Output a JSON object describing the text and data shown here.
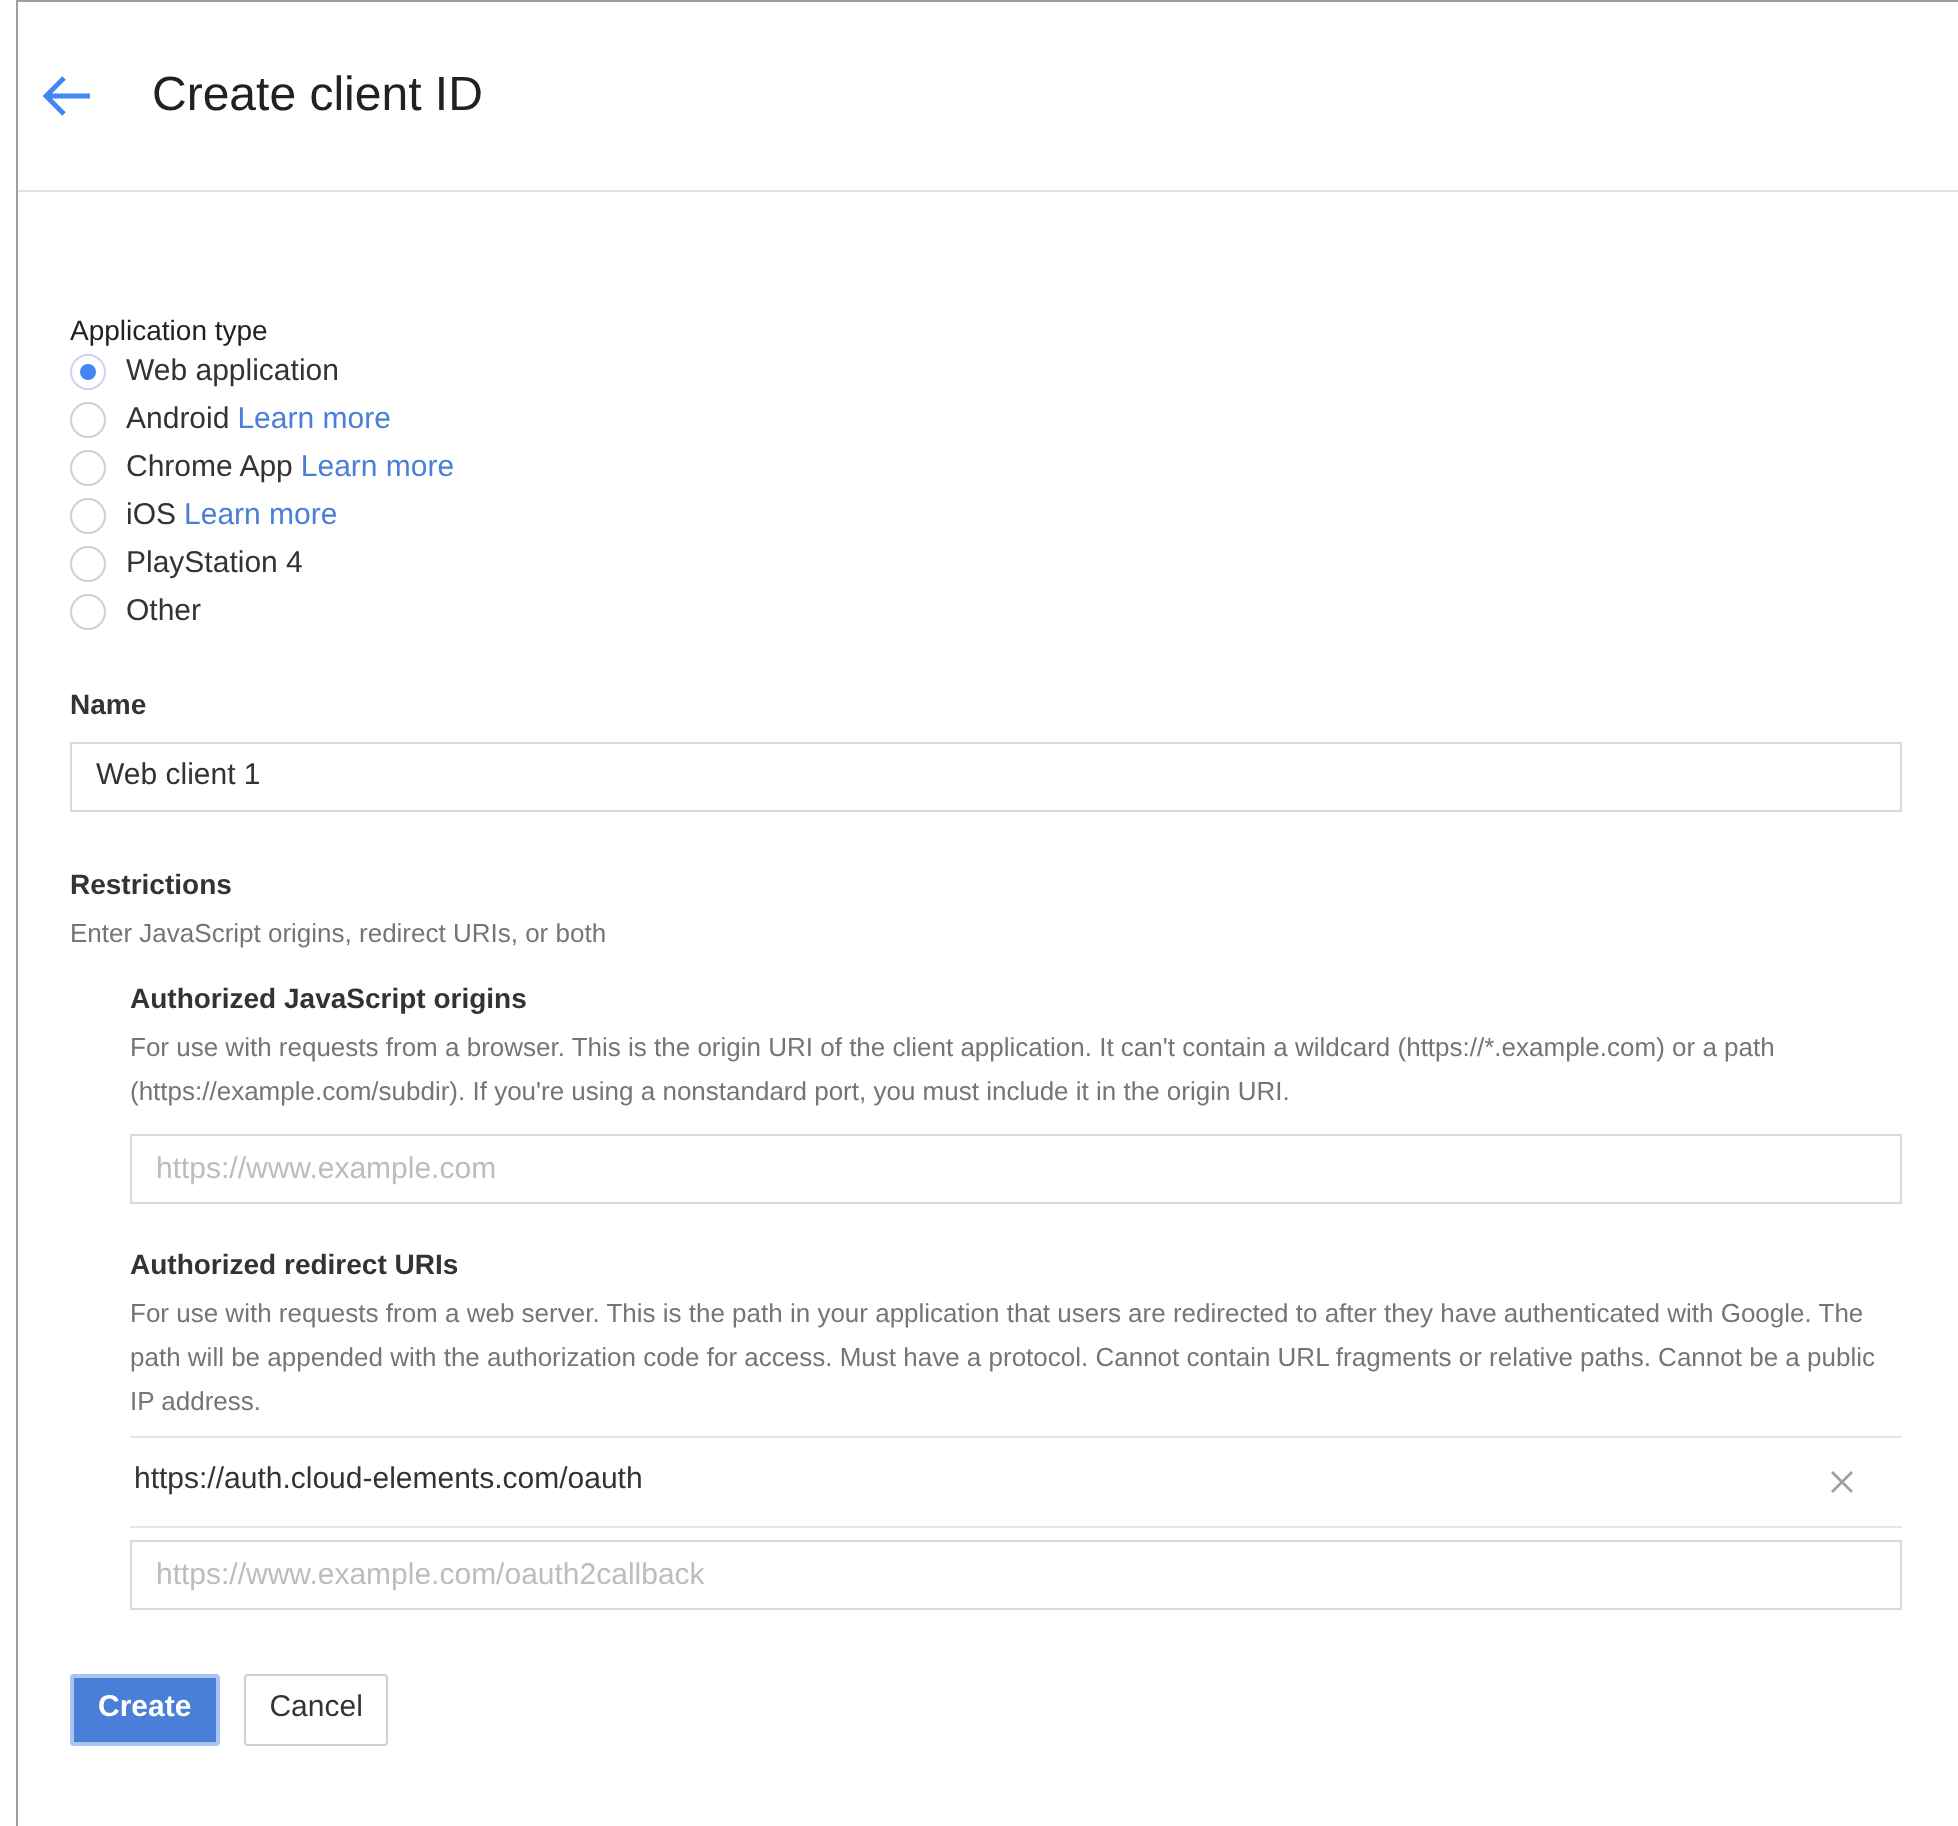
{
  "header": {
    "title": "Create client ID"
  },
  "application_type": {
    "label": "Application type",
    "options": [
      {
        "label": "Web application",
        "selected": true
      },
      {
        "label": "Android",
        "link": "Learn more",
        "selected": false
      },
      {
        "label": "Chrome App",
        "link": "Learn more",
        "selected": false
      },
      {
        "label": "iOS",
        "link": "Learn more",
        "selected": false
      },
      {
        "label": "PlayStation 4",
        "selected": false
      },
      {
        "label": "Other",
        "selected": false
      }
    ]
  },
  "name": {
    "label": "Name",
    "value": "Web client 1"
  },
  "restrictions": {
    "label": "Restrictions",
    "hint": "Enter JavaScript origins, redirect URIs, or both",
    "sections": [
      {
        "title": "Authorized JavaScript origins",
        "description": "For use with requests from a browser. This is the origin URI of the client application. It can't contain a wildcard (https://*.example.com) or a path (https://example.com/subdir). If you're using a nonstandard port, you must include it in the origin URI.",
        "placeholder": "https://www.example.com"
      },
      {
        "title": "Authorized redirect URIs",
        "description": "For use with requests from a web server. This is the path in your application that users are redirected to after they have authenticated with Google. The path will be appended with the authorization code for access. Must have a protocol. Cannot contain URL fragments or relative paths. Cannot be a public IP address.",
        "entries": [
          "https://auth.cloud-elements.com/oauth"
        ],
        "placeholder": "https://www.example.com/oauth2callback"
      }
    ]
  },
  "buttons": [
    {
      "label": "Create",
      "kind": "primary"
    },
    {
      "label": "Cancel",
      "kind": "secondary"
    }
  ]
}
